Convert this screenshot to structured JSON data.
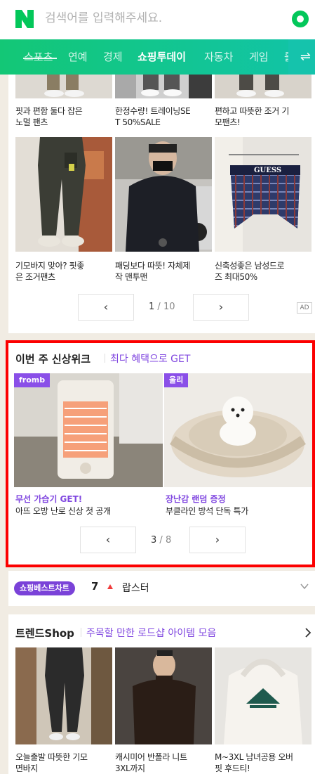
{
  "header": {
    "search_placeholder": "검색어를 입력해주세요.",
    "brand_color": "#03c75a"
  },
  "nav": {
    "items": [
      "스포츠",
      "연예",
      "경제",
      "쇼핑투데이",
      "자동차",
      "게임",
      "를"
    ],
    "active_index": 3,
    "menu_icon": "swap-icon"
  },
  "section1": {
    "items": [
      {
        "title_line1": "핏과 편함 둘다 잡은",
        "title_line2": "노멀 팬츠"
      },
      {
        "title_line1": "한정수량! 트레이닝SE",
        "title_line2": "T 50%SALE"
      },
      {
        "title_line1": "편하고 따뜻한 조거 기",
        "title_line2": "모팬츠!"
      },
      {
        "title_line1": "기모바지 맞아? 핏좋",
        "title_line2": "은 조거팬츠"
      },
      {
        "title_line1": "패딩보다 따뜻! 자체제",
        "title_line2": "작 맨투맨"
      },
      {
        "title_line1": "신축성좋은 남성드로",
        "title_line2": "즈 최대50%"
      }
    ],
    "pager": {
      "current": "1",
      "sep": "/",
      "total": "10",
      "prev": "‹",
      "next": "›"
    },
    "ad_label": "AD",
    "brand_text": "GUESS"
  },
  "section2": {
    "title": "이번 주 신상위크",
    "subtitle": "최다 혜택으로 GET",
    "items": [
      {
        "tag": "fromb",
        "name": "무선 가습기 GET!",
        "desc": "아뜨 오방 난로 신상 첫 공개"
      },
      {
        "tag": "울리",
        "name": "장난감 랜덤 증정",
        "desc": "부클라인 방석 단독 특가"
      }
    ],
    "pager": {
      "current": "3",
      "sep": "/",
      "total": "8",
      "prev": "‹",
      "next": "›"
    },
    "highlight_color": "#fc0000"
  },
  "section3": {
    "badge": "쇼핑베스트차트",
    "rank": "7",
    "name": "랍스터"
  },
  "section4": {
    "title": "트렌드Shop",
    "subtitle": "주목할 만한 로드샵 아이템 모음",
    "items": [
      {
        "title_line1": "오늘출발 따뜻한 기모",
        "title_line2": "면바지"
      },
      {
        "title_line1": "캐시미어 반폴라 니트",
        "title_line2": "3XL까지"
      },
      {
        "title_line1": "M~3XL 남녀공용 오버",
        "title_line2": "핏 후드티!"
      }
    ]
  }
}
